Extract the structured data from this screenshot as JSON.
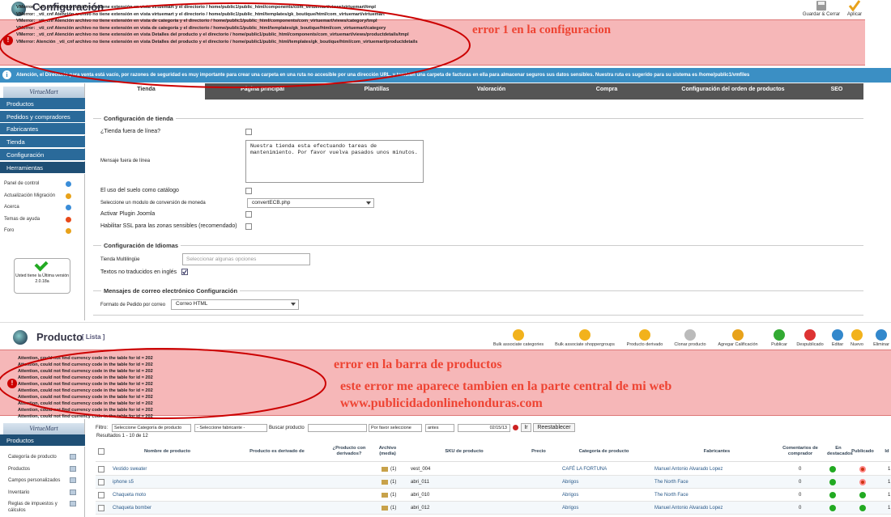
{
  "config": {
    "title": "Configuración",
    "toolbar": {
      "save_close": "Guardar & Cerrar",
      "apply": "Aplicar"
    },
    "errors": [
      "VMerror: _vti_cnf Atención archivo no tiene extensión en vista virtuemart y el directorio / home/public1/public_html/components/com_virtuemart/views/virtuemart/tmpl",
      "VMerror: _vti_cnf Atención archivo no tiene extensión en vista virtuemart y el directorio / home/public1/public_html/templates/gk_boutique/html/com_virtuemart/virtuemart",
      "VMerror: _vti_cnf Atención archivo no tiene extensión en vista de categoría y el directorio / home/public1/public_html/components/com_virtuemart/views/category/tmpl",
      "VMerror: _vti_cnf Atención archivo no tiene extensión en vista de categoría y el directorio / home/public1/public_html/templates/gk_boutique/html/com_virtuemart/category",
      "VMerror: _vti_cnf Atención archivo no tiene extensión en vista Detalles del producto y el directorio / home/public1/public_html/components/com_virtuemart/views/productdetails/tmpl",
      "VMerror: Atención _vti_cnf archivo no tiene extensión en vista Detalles del producto y el directorio / home/public1/public_html/templates/gk_boutique/html/com_virtuemart/productdetails"
    ],
    "annotation": "error  1   en la configuracion",
    "info": "Atención, el Directorio para venta está vacío, por razones de seguridad es muy importante para crear una carpeta en una ruta no accesible por una dirección URL, y  también una carpeta de facturas en ella para almacenar seguros sus datos sensibles. Nuestra ruta es sugerido para su sistema es /home/public1/vmfiles",
    "sidebar": {
      "logo": "VirtueMart",
      "items": [
        "Productos",
        "Pedidos y compradores",
        "Fabricantes",
        "Tienda",
        "Configuración",
        "Herramientas"
      ],
      "sub": [
        "Panel de control",
        "Actualización Migración",
        "Acerca",
        "Temas de ayuda",
        "Foro"
      ],
      "update_text": "Usted tiene la Última versión 2.0.18a"
    },
    "tabs": [
      "Tienda",
      "Página principal",
      "Plantillas",
      "Valoración",
      "Compra",
      "Configuración del orden de productos",
      "SEO"
    ],
    "shop": {
      "legend": "Configuración de tienda",
      "offline_label": "¿Tienda fuera de línea?",
      "offline_msg_label": "Mensaje fuera de línea",
      "offline_msg": "Nuestra tienda esta efectuando tareas de mantenimiento. Por favor vuelva pasados unos minutos.",
      "catalog_label": "El uso del suelo como catálogo",
      "currency_module_label": "Seleccione un modulo de conversión de moneda",
      "currency_module": "convertECB.php",
      "joomla_plugin_label": "Activar Plugin Joomla",
      "ssl_label": "Habilitar SSL para las zonas sensibles (recomendado)"
    },
    "lang": {
      "legend": "Configuración de Idiomas",
      "multilang_label": "Tienda Multilingüe",
      "multilang_placeholder": "Seleccionar algunas opciones",
      "untranslated_label": "Textos no traducidos en inglés"
    },
    "mail": {
      "legend": "Mensajes de correo electrónico Configuración",
      "format_label": "Formato de Pedido por correo",
      "format_value": "Correo HTML"
    }
  },
  "product": {
    "title": "Producto",
    "subtitle": "[ Lista ]",
    "toolbar": [
      "Bulk associate categories",
      "Bulk associate shoppergroups",
      "Producto derivado",
      "Clonar producto",
      "Agregar Calificación",
      "Publicar",
      "Despublicado",
      "Editar",
      "Nuevo",
      "Eliminar"
    ],
    "errors": [
      "Attention, could not find currency code in the table for id = 202",
      "Attention, could not find currency code in the table for id = 202",
      "Attention, could not find currency code in the table for id = 202",
      "Attention, could not find currency code in the table for id = 202",
      "Attention, could not find currency code in the table for id = 202",
      "Attention, could not find currency code in the table for id = 202",
      "Attention, could not find currency code in the table for id = 202",
      "Attention, could not find currency code in the table for id = 202",
      "Attention, could not find currency code in the table for id = 202",
      "Attention, could not find currency code in the table for id = 202"
    ],
    "annotation_1": "error en la barra de productos",
    "annotation_2": "este error me aparece tambien en la parte central de mi web",
    "annotation_3": "www.publicidadonlinehonduras.com",
    "sidebar": {
      "logo": "VirtueMart",
      "section": "Productos",
      "sub": [
        "Categoría de producto",
        "Productos",
        "Campos personalizados",
        "Inventario",
        "Reglas de impuestos y cálculos"
      ]
    },
    "filter": {
      "label": "Filtro:",
      "category": "Seleccione Categoría de producto",
      "manufacturer": "- Seleccione fabricante -",
      "search_label": "Buscar producto",
      "order_by": "Por favor seleccione",
      "before": "antes",
      "date": "02/15/13",
      "go": "Ir",
      "reset": "Reestablecer",
      "results": "Resultados 1 - 10 de 12"
    },
    "columns": [
      "Nombre de producto",
      "Producto es derivado de",
      "¿Producto con derivados?",
      "Archivo (media)",
      "SKU de producto",
      "Precio",
      "Categoría de producto",
      "Fabricantes",
      "Comentarios de comprador",
      "En destacados",
      "Publicado",
      "Id"
    ],
    "rows": [
      {
        "name": "Vestido sweater",
        "media": "(1)",
        "sku": "vest_004",
        "category": "CAFÉ LA FORTUNA",
        "manufacturer": "Manuel Antonio Alvarado Lopez",
        "comments": "0",
        "featured": "green",
        "published": "red",
        "id": "1"
      },
      {
        "name": "iphone s5",
        "media": "(1)",
        "sku": "abri_011",
        "category": "Abrigos",
        "manufacturer": "The North Face",
        "comments": "0",
        "featured": "green",
        "published": "red",
        "id": "1"
      },
      {
        "name": "Chaqueta moto",
        "media": "(1)",
        "sku": "abri_010",
        "category": "Abrigos",
        "manufacturer": "The North Face",
        "comments": "0",
        "featured": "green",
        "published": "green",
        "id": "1"
      },
      {
        "name": "Chaqueta bomber",
        "media": "(1)",
        "sku": "abri_012",
        "category": "Abrigos",
        "manufacturer": "Manuel Antonio Alvarado Lopez",
        "comments": "0",
        "featured": "green",
        "published": "green",
        "id": "1"
      }
    ]
  },
  "colors": {
    "error_bg": "#f6b7b8",
    "info_bg": "#3b8fc4",
    "sidebar_bg": "#2a6a9a",
    "annotation": "#ee4433",
    "ellipse": "#cc0000"
  }
}
